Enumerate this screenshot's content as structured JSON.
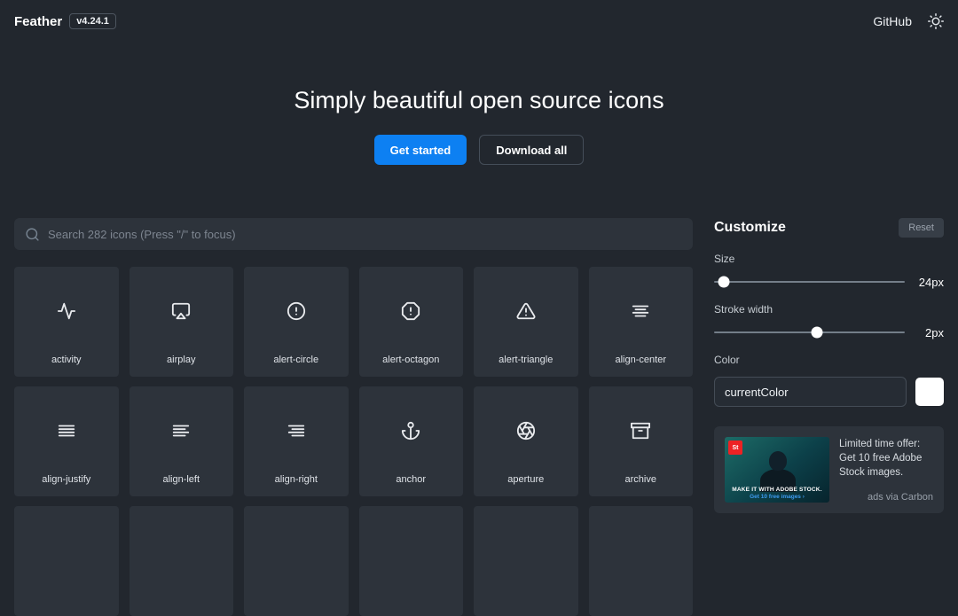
{
  "header": {
    "logo": "Feather",
    "version": "v4.24.1",
    "github_label": "GitHub"
  },
  "hero": {
    "title": "Simply beautiful open source icons",
    "get_started_label": "Get started",
    "download_all_label": "Download all"
  },
  "search": {
    "placeholder": "Search 282 icons (Press \"/\" to focus)"
  },
  "grid": {
    "icons": [
      {
        "label": "activity"
      },
      {
        "label": "airplay"
      },
      {
        "label": "alert-circle"
      },
      {
        "label": "alert-octagon"
      },
      {
        "label": "alert-triangle"
      },
      {
        "label": "align-center"
      },
      {
        "label": "align-justify"
      },
      {
        "label": "align-left"
      },
      {
        "label": "align-right"
      },
      {
        "label": "anchor"
      },
      {
        "label": "aperture"
      },
      {
        "label": "archive"
      }
    ]
  },
  "customize": {
    "title": "Customize",
    "reset_label": "Reset",
    "size_label": "Size",
    "size_value": "24px",
    "stroke_label": "Stroke width",
    "stroke_value": "2px",
    "color_label": "Color",
    "color_value": "currentColor",
    "swatch_color": "#ffffff"
  },
  "ad": {
    "logo_text": "St",
    "image_caption": "MAKE IT WITH ADOBE STOCK.",
    "image_cta": "Get 10 free images ›",
    "body": "Limited time offer: Get 10 free Adobe Stock images.",
    "attribution": "ads via Carbon"
  },
  "colors": {
    "accent": "#0d80f2",
    "background": "#22272e",
    "card": "#2d333b"
  }
}
